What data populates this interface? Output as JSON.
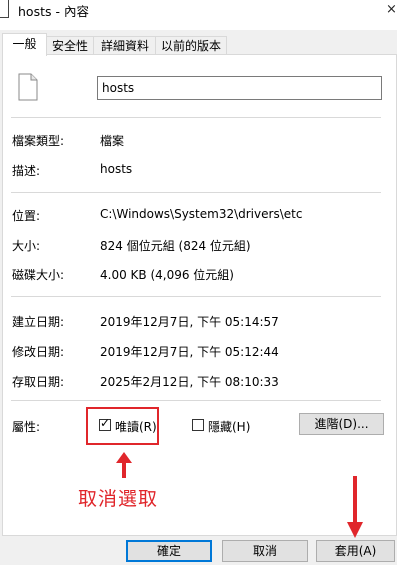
{
  "window": {
    "title": "hosts - 內容",
    "close_glyph": "×"
  },
  "tabs": [
    {
      "label": "一般"
    },
    {
      "label": "安全性"
    },
    {
      "label": "詳細資料"
    },
    {
      "label": "以前的版本"
    }
  ],
  "general": {
    "icon": "file-icon",
    "name_value": "hosts",
    "fields": {
      "type": {
        "label": "檔案類型:",
        "value": "檔案"
      },
      "description": {
        "label": "描述:",
        "value": "hosts"
      },
      "location": {
        "label": "位置:",
        "value": "C:\\Windows\\System32\\drivers\\etc"
      },
      "size": {
        "label": "大小:",
        "value": "824 個位元組 (824 位元組)"
      },
      "size_on_disk": {
        "label": "磁碟大小:",
        "value": "4.00 KB (4,096 位元組)"
      },
      "created": {
        "label": "建立日期:",
        "value": "2019年12月7日, 下午 05:14:57"
      },
      "modified": {
        "label": "修改日期:",
        "value": "2019年12月7日, 下午 05:12:44"
      },
      "accessed": {
        "label": "存取日期:",
        "value": "2025年2月12日, 下午 08:10:33"
      }
    },
    "attributes": {
      "label": "屬性:",
      "readonly": {
        "label": "唯讀(R)",
        "checked": true,
        "check_glyph": "✓"
      },
      "hidden": {
        "label": "隱藏(H)",
        "checked": false
      },
      "advanced_button": "進階(D)..."
    }
  },
  "annotation": {
    "text": "取消選取",
    "color": "#e0262b"
  },
  "buttons": {
    "ok": "確定",
    "cancel": "取消",
    "apply": "套用(A)"
  },
  "colors": {
    "accent": "#0078d7",
    "annotation_red": "#e0262b"
  }
}
